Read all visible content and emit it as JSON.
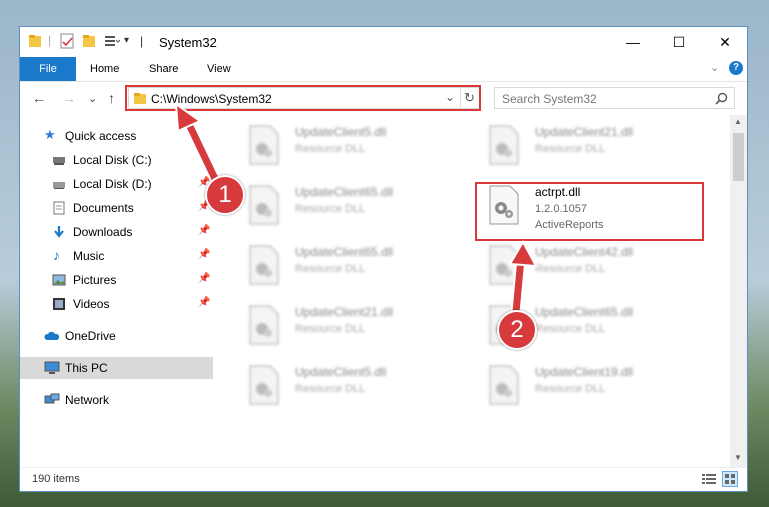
{
  "window": {
    "title": "System32",
    "min": "—",
    "max": "☐",
    "close": "✕"
  },
  "ribbon": {
    "file": "File",
    "home": "Home",
    "share": "Share",
    "view": "View",
    "collapse": "⌄",
    "help": "?"
  },
  "nav": {
    "back": "←",
    "forward": "→",
    "recent": "⌄",
    "up": "↑",
    "address": "C:\\Windows\\System32",
    "address_dropdown": "⌄",
    "refresh": "↻",
    "search_placeholder": "Search System32"
  },
  "sidebar": {
    "items": [
      {
        "label": "Quick access"
      },
      {
        "label": "Local Disk (C:)"
      },
      {
        "label": "Local Disk (D:)"
      },
      {
        "label": "Documents"
      },
      {
        "label": "Downloads"
      },
      {
        "label": "Music"
      },
      {
        "label": "Pictures"
      },
      {
        "label": "Videos"
      },
      {
        "label": "OneDrive"
      },
      {
        "label": "This PC"
      },
      {
        "label": "Network"
      }
    ]
  },
  "files": [
    {
      "name": "UpdateClient5.dll",
      "type": "Resource DLL"
    },
    {
      "name": "UpdateClient21.dll",
      "type": "Resource DLL"
    },
    {
      "name": "UpdateClient65.dll",
      "type": "Resource DLL"
    },
    {
      "name": "actrpt.dll",
      "version": "1.2.0.1057",
      "type": "ActiveReports"
    },
    {
      "name": "UpdateClient65.dll",
      "type": "Resource DLL"
    },
    {
      "name": "UpdateClient42.dll",
      "type": "Resource DLL"
    },
    {
      "name": "UpdateClient21.dll",
      "type": "Resource DLL"
    },
    {
      "name": "UpdateClient65.dll",
      "type": "Resource DLL"
    },
    {
      "name": "UpdateClient5.dll",
      "type": "Resource DLL"
    },
    {
      "name": "UpdateClient19.dll",
      "type": "Resource DLL"
    }
  ],
  "status": {
    "count": "190 items"
  },
  "annotations": {
    "step1": "1",
    "step2": "2"
  },
  "colors": {
    "accent": "#1979ca",
    "highlight": "#d9373a"
  }
}
